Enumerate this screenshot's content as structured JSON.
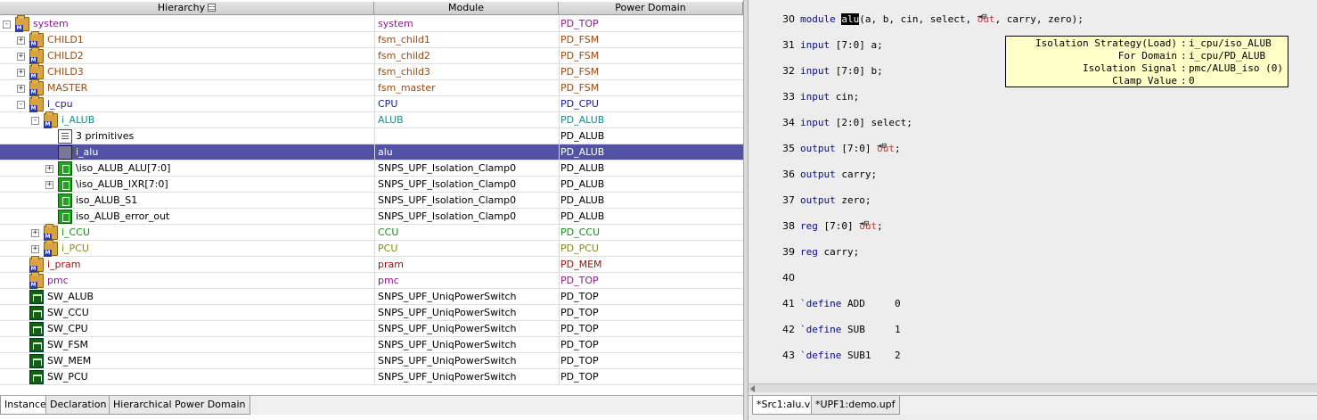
{
  "hierarchy_panel": {
    "columns": {
      "hierarchy": "Hierarchy",
      "module": "Module",
      "power_domain": "Power Domain"
    },
    "rows": [
      {
        "name": "system",
        "module": "system",
        "pd": "PD_TOP",
        "color": "#8a1a8a",
        "pdcolor": "#8a1a8a",
        "indent": 0,
        "exp": "-",
        "icon": "folder"
      },
      {
        "name": "CHILD1",
        "module": "fsm_child1",
        "pd": "PD_FSM",
        "color": "#9a4a10",
        "pdcolor": "#9a4a10",
        "indent": 1,
        "exp": "+",
        "icon": "folder"
      },
      {
        "name": "CHILD2",
        "module": "fsm_child2",
        "pd": "PD_FSM",
        "color": "#9a4a10",
        "pdcolor": "#9a4a10",
        "indent": 1,
        "exp": "+",
        "icon": "folder"
      },
      {
        "name": "CHILD3",
        "module": "fsm_child3",
        "pd": "PD_FSM",
        "color": "#9a4a10",
        "pdcolor": "#9a4a10",
        "indent": 1,
        "exp": "+",
        "icon": "folder"
      },
      {
        "name": "MASTER",
        "module": "fsm_master",
        "pd": "PD_FSM",
        "color": "#9a4a10",
        "pdcolor": "#9a4a10",
        "indent": 1,
        "exp": "+",
        "icon": "folder"
      },
      {
        "name": "i_cpu",
        "module": "CPU",
        "pd": "PD_CPU",
        "color": "#1a1a9a",
        "pdcolor": "#1a1a9a",
        "indent": 1,
        "exp": "-",
        "icon": "folder"
      },
      {
        "name": "i_ALUB",
        "module": "ALUB",
        "pd": "PD_ALUB",
        "color": "#1a8a8a",
        "pdcolor": "#1a8a8a",
        "indent": 2,
        "exp": "-",
        "icon": "folder"
      },
      {
        "name": "3 primitives",
        "module": "",
        "pd": "PD_ALUB",
        "color": "#000000",
        "pdcolor": "#000000",
        "indent": 3,
        "exp": "",
        "icon": "prim"
      },
      {
        "name": "i_alu",
        "module": "alu",
        "pd": "PD_ALUB",
        "color": "#ffffff",
        "pdcolor": "#ffffff",
        "indent": 3,
        "exp": "",
        "icon": "inst",
        "selected": true
      },
      {
        "name": "\\iso_ALUB_ALU[7:0]",
        "module": "SNPS_UPF_Isolation_Clamp0",
        "pd": "PD_ALUB",
        "color": "#000000",
        "pdcolor": "#000000",
        "indent": 3,
        "exp": "+",
        "icon": "iso"
      },
      {
        "name": "\\iso_ALUB_IXR[7:0]",
        "module": "SNPS_UPF_Isolation_Clamp0",
        "pd": "PD_ALUB",
        "color": "#000000",
        "pdcolor": "#000000",
        "indent": 3,
        "exp": "+",
        "icon": "iso"
      },
      {
        "name": "iso_ALUB_S1",
        "module": "SNPS_UPF_Isolation_Clamp0",
        "pd": "PD_ALUB",
        "color": "#000000",
        "pdcolor": "#000000",
        "indent": 3,
        "exp": "",
        "icon": "iso"
      },
      {
        "name": "iso_ALUB_error_out",
        "module": "SNPS_UPF_Isolation_Clamp0",
        "pd": "PD_ALUB",
        "color": "#000000",
        "pdcolor": "#000000",
        "indent": 3,
        "exp": "",
        "icon": "iso"
      },
      {
        "name": "i_CCU",
        "module": "CCU",
        "pd": "PD_CCU",
        "color": "#1a8a1a",
        "pdcolor": "#1a8a1a",
        "indent": 2,
        "exp": "+",
        "icon": "folder"
      },
      {
        "name": "i_PCU",
        "module": "PCU",
        "pd": "PD_PCU",
        "color": "#8a8a10",
        "pdcolor": "#8a8a10",
        "indent": 2,
        "exp": "+",
        "icon": "folder"
      },
      {
        "name": "i_pram",
        "module": "pram",
        "pd": "PD_MEM",
        "color": "#9a1010",
        "pdcolor": "#9a1010",
        "indent": 1,
        "exp": "",
        "icon": "folder"
      },
      {
        "name": "pmc",
        "module": "pmc",
        "pd": "PD_TOP",
        "color": "#8a1a8a",
        "pdcolor": "#8a1a8a",
        "indent": 1,
        "exp": "",
        "icon": "folder"
      },
      {
        "name": "SW_ALUB",
        "module": "SNPS_UPF_UniqPowerSwitch",
        "pd": "PD_TOP",
        "color": "#000000",
        "pdcolor": "#000000",
        "indent": 1,
        "exp": "",
        "icon": "switch"
      },
      {
        "name": "SW_CCU",
        "module": "SNPS_UPF_UniqPowerSwitch",
        "pd": "PD_TOP",
        "color": "#000000",
        "pdcolor": "#000000",
        "indent": 1,
        "exp": "",
        "icon": "switch"
      },
      {
        "name": "SW_CPU",
        "module": "SNPS_UPF_UniqPowerSwitch",
        "pd": "PD_TOP",
        "color": "#000000",
        "pdcolor": "#000000",
        "indent": 1,
        "exp": "",
        "icon": "switch"
      },
      {
        "name": "SW_FSM",
        "module": "SNPS_UPF_UniqPowerSwitch",
        "pd": "PD_TOP",
        "color": "#000000",
        "pdcolor": "#000000",
        "indent": 1,
        "exp": "",
        "icon": "switch"
      },
      {
        "name": "SW_MEM",
        "module": "SNPS_UPF_UniqPowerSwitch",
        "pd": "PD_TOP",
        "color": "#000000",
        "pdcolor": "#000000",
        "indent": 1,
        "exp": "",
        "icon": "switch"
      },
      {
        "name": "SW_PCU",
        "module": "SNPS_UPF_UniqPowerSwitch",
        "pd": "PD_TOP",
        "color": "#000000",
        "pdcolor": "#000000",
        "indent": 1,
        "exp": "",
        "icon": "switch"
      }
    ],
    "tabs": [
      "Instance",
      "Declaration",
      "Hierarchical Power Domain"
    ],
    "active_tab": "Instance"
  },
  "source_panel": {
    "lines": [
      {
        "num": "30",
        "parts": [
          [
            "module ",
            "kw"
          ],
          [
            "alu",
            "hl"
          ],
          [
            "(a, b, cin, select, ",
            ""
          ],
          [
            "out",
            "red-pin"
          ],
          [
            ", carry, zero);",
            ""
          ]
        ]
      },
      {
        "num": "31",
        "parts": [
          [
            "input ",
            "kw"
          ],
          [
            "[7:0] a;",
            ""
          ]
        ]
      },
      {
        "num": "32",
        "parts": [
          [
            "input ",
            "kw"
          ],
          [
            "[7:0] b;",
            ""
          ]
        ]
      },
      {
        "num": "33",
        "parts": [
          [
            "input ",
            "kw"
          ],
          [
            "cin;",
            ""
          ]
        ]
      },
      {
        "num": "34",
        "parts": [
          [
            "input ",
            "kw"
          ],
          [
            "[2:0] select;",
            ""
          ]
        ]
      },
      {
        "num": "35",
        "parts": [
          [
            "output ",
            "kw"
          ],
          [
            "[7:0] ",
            ""
          ],
          [
            "out",
            "red-pin"
          ],
          [
            ";",
            ""
          ]
        ]
      },
      {
        "num": "36",
        "parts": [
          [
            "output ",
            "kw"
          ],
          [
            "carry;",
            ""
          ]
        ]
      },
      {
        "num": "37",
        "parts": [
          [
            "output ",
            "kw"
          ],
          [
            "zero;",
            ""
          ]
        ]
      },
      {
        "num": "38",
        "parts": [
          [
            "reg ",
            "kw"
          ],
          [
            "[7:0] ",
            ""
          ],
          [
            "out",
            "red-pin"
          ],
          [
            ";",
            ""
          ]
        ]
      },
      {
        "num": "39",
        "parts": [
          [
            "reg ",
            "kw"
          ],
          [
            "carry;",
            ""
          ]
        ]
      },
      {
        "num": "40",
        "parts": []
      },
      {
        "num": "41",
        "parts": [
          [
            "`define ",
            "kw"
          ],
          [
            "ADD     0",
            ""
          ]
        ]
      },
      {
        "num": "42",
        "parts": [
          [
            "`define ",
            "kw"
          ],
          [
            "SUB     1",
            ""
          ]
        ]
      },
      {
        "num": "43",
        "parts": [
          [
            "`define ",
            "kw"
          ],
          [
            "SUB1    2",
            ""
          ]
        ]
      }
    ],
    "tooltip": [
      {
        "key": "Isolation Strategy(Load)",
        "value": "i_cpu/iso_ALUB"
      },
      {
        "key": "For Domain",
        "value": "i_cpu/PD_ALUB"
      },
      {
        "key": "Isolation Signal",
        "value": "pmc/ALUB_iso (0)"
      },
      {
        "key": "Clamp Value",
        "value": "0"
      }
    ],
    "pin_glyph": "⇥⊟",
    "tabs": [
      "*Src1:alu.v",
      "*UPF1:demo.upf"
    ],
    "active_tab": "*Src1:alu.v"
  }
}
